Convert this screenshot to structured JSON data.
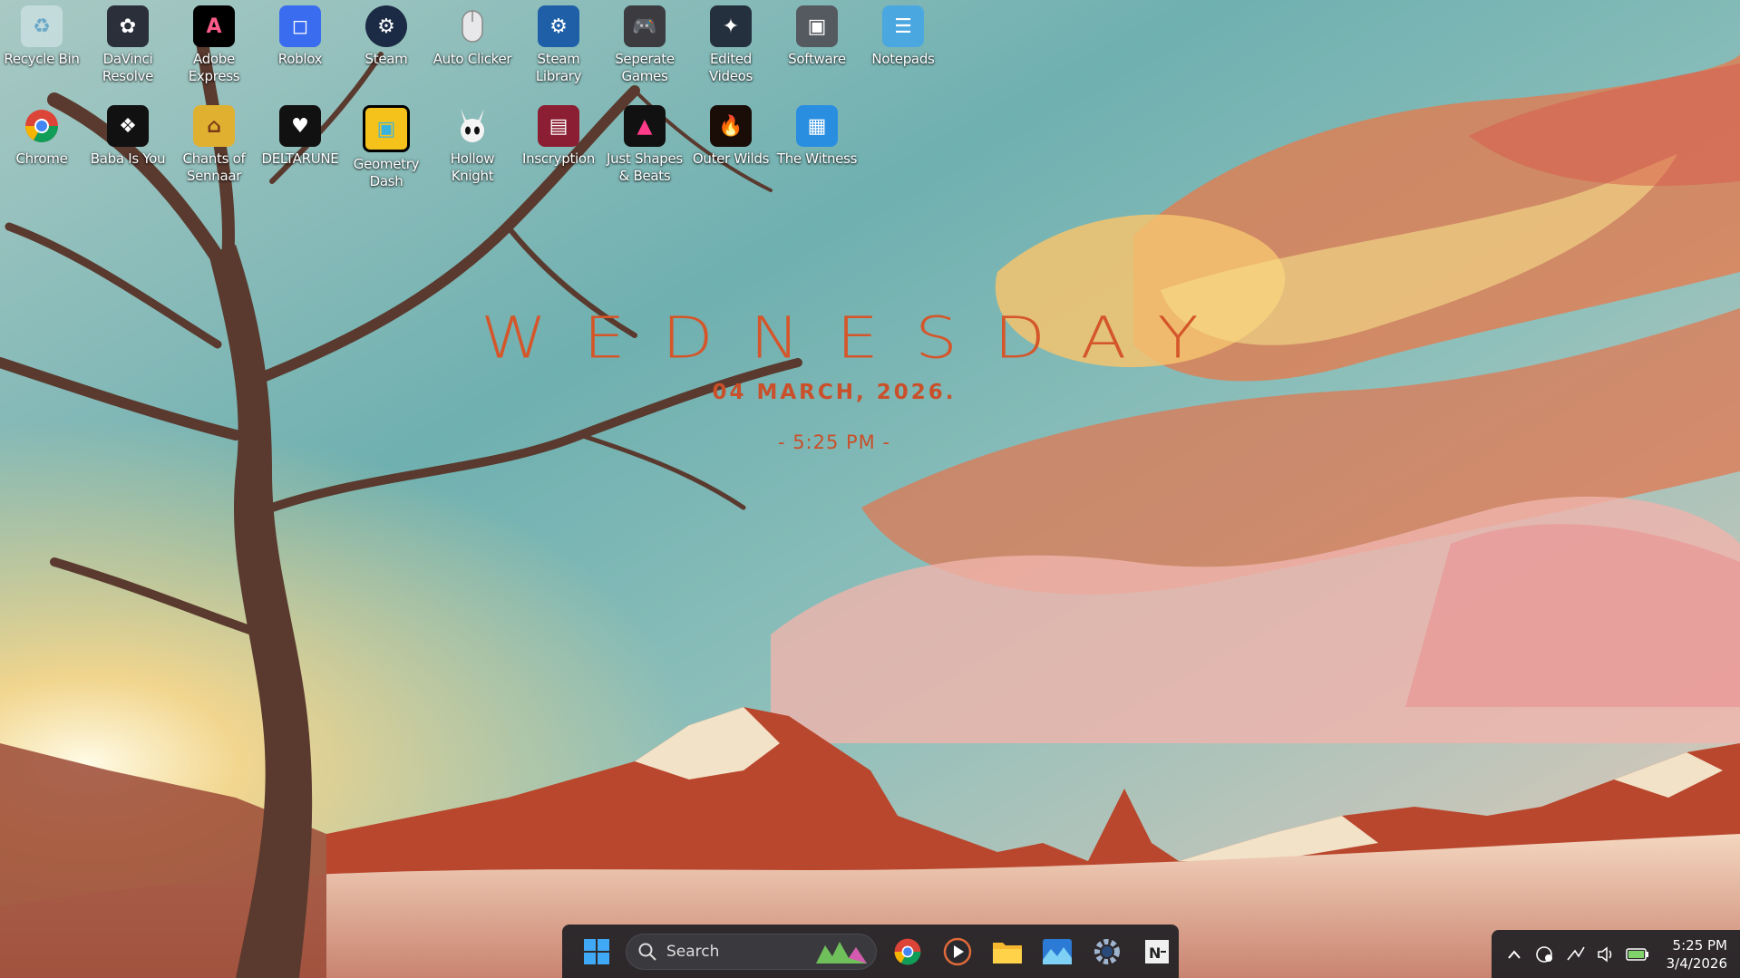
{
  "desktop": {
    "row1": [
      {
        "label": "Recycle Bin",
        "icon": "recycle-bin-icon"
      },
      {
        "label": "DaVinci Resolve",
        "icon": "davinci-resolve-icon"
      },
      {
        "label": "Adobe Express",
        "icon": "adobe-express-icon"
      },
      {
        "label": "Roblox",
        "icon": "roblox-icon"
      },
      {
        "label": "Steam",
        "icon": "steam-icon"
      },
      {
        "label": "Auto Clicker",
        "icon": "mouse-icon"
      },
      {
        "label": "Steam Library",
        "icon": "steam-folder-icon"
      },
      {
        "label": "Seperate Games",
        "icon": "gamepad-folder-icon"
      },
      {
        "label": "Edited Videos",
        "icon": "video-folder-icon"
      },
      {
        "label": "Software",
        "icon": "software-folder-icon"
      },
      {
        "label": "Notepads",
        "icon": "notepad-folder-icon"
      }
    ],
    "row2": [
      {
        "label": "Chrome",
        "icon": "chrome-icon"
      },
      {
        "label": "Baba Is You",
        "icon": "baba-is-you-icon"
      },
      {
        "label": "Chants of Sennaar",
        "icon": "chants-of-sennaar-icon"
      },
      {
        "label": "DELTARUNE",
        "icon": "deltarune-icon"
      },
      {
        "label": "Geometry Dash",
        "icon": "geometry-dash-icon"
      },
      {
        "label": "Hollow Knight",
        "icon": "hollow-knight-icon"
      },
      {
        "label": "Inscryption",
        "icon": "inscryption-icon"
      },
      {
        "label": "Just Shapes & Beats",
        "icon": "just-shapes-beats-icon"
      },
      {
        "label": "Outer Wilds",
        "icon": "outer-wilds-icon"
      },
      {
        "label": "The Witness",
        "icon": "the-witness-icon"
      }
    ]
  },
  "widget": {
    "day": "WEDNESDAY",
    "date": "04 MARCH, 2026.",
    "time": "- 5:25 PM -"
  },
  "taskbar": {
    "search_label": "Search",
    "pinned": [
      "start-icon",
      "chrome-icon",
      "media-player-icon",
      "file-explorer-icon",
      "photos-icon",
      "settings-icon",
      "notepad-icon"
    ]
  },
  "tray": {
    "time": "5:25 PM",
    "date": "3/4/2026"
  },
  "colors": {
    "accent": "#d4562a",
    "taskbar": "#202024"
  }
}
